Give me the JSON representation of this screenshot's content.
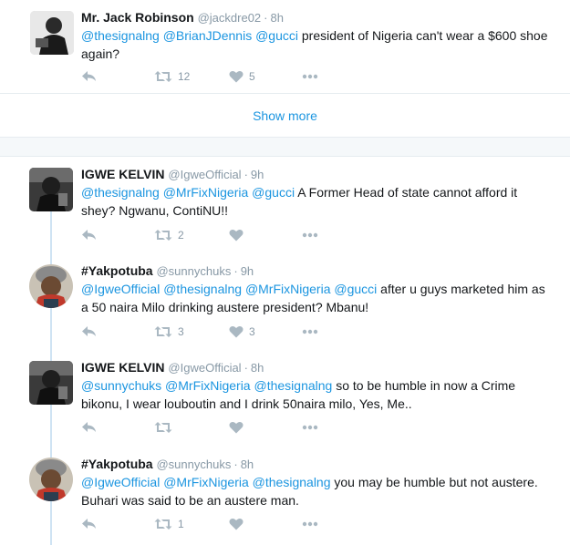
{
  "tweets": [
    {
      "name": "Mr. Jack Robinson",
      "handle": "@jackdre02",
      "time": "8h",
      "body": [
        {
          "t": "@thesignalng",
          "m": true
        },
        {
          "t": " "
        },
        {
          "t": "@BrianJDennis",
          "m": true
        },
        {
          "t": " "
        },
        {
          "t": "@gucci",
          "m": true
        },
        {
          "t": " president of Nigeria can't wear a $600 shoe again?"
        }
      ],
      "retweets": "12",
      "likes": "5"
    },
    {
      "name": "IGWE KELVIN",
      "handle": "@IgweOfficial",
      "time": "9h",
      "body": [
        {
          "t": "@thesignalng",
          "m": true
        },
        {
          "t": " "
        },
        {
          "t": "@MrFixNigeria",
          "m": true
        },
        {
          "t": " "
        },
        {
          "t": "@gucci",
          "m": true
        },
        {
          "t": " A Former Head of state cannot afford it shey? Ngwanu, ContiNU!!"
        }
      ],
      "retweets": "2",
      "likes": ""
    },
    {
      "name": "#Yakpotuba",
      "handle": "@sunnychuks",
      "time": "9h",
      "body": [
        {
          "t": "@IgweOfficial",
          "m": true
        },
        {
          "t": " "
        },
        {
          "t": "@thesignalng",
          "m": true
        },
        {
          "t": " "
        },
        {
          "t": "@MrFixNigeria",
          "m": true
        },
        {
          "t": " "
        },
        {
          "t": "@gucci",
          "m": true
        },
        {
          "t": " after u guys marketed him as a 50 naira Milo drinking austere president? Mbanu!"
        }
      ],
      "retweets": "3",
      "likes": "3"
    },
    {
      "name": "IGWE KELVIN",
      "handle": "@IgweOfficial",
      "time": "8h",
      "body": [
        {
          "t": "@sunnychuks",
          "m": true
        },
        {
          "t": " "
        },
        {
          "t": "@MrFixNigeria",
          "m": true
        },
        {
          "t": " "
        },
        {
          "t": "@thesignalng",
          "m": true
        },
        {
          "t": " so to be humble in now a Crime bikonu, I wear louboutin and I drink 50naira milo, Yes, Me.."
        }
      ],
      "retweets": "",
      "likes": ""
    },
    {
      "name": "#Yakpotuba",
      "handle": "@sunnychuks",
      "time": "8h",
      "body": [
        {
          "t": "@IgweOfficial",
          "m": true
        },
        {
          "t": " "
        },
        {
          "t": "@MrFixNigeria",
          "m": true
        },
        {
          "t": " "
        },
        {
          "t": "@thesignalng",
          "m": true
        },
        {
          "t": " you may be humble but not austere. Buhari was said to be an austere man."
        }
      ],
      "retweets": "1",
      "likes": ""
    }
  ],
  "show_more": "Show more",
  "icons": {
    "reply": "reply-icon",
    "retweet": "retweet-icon",
    "like": "heart-icon",
    "more": "more-icon"
  },
  "colors": {
    "mention": "#1b95e0",
    "icon": "#aab8c2",
    "thread_line": "#cfe3f3"
  }
}
